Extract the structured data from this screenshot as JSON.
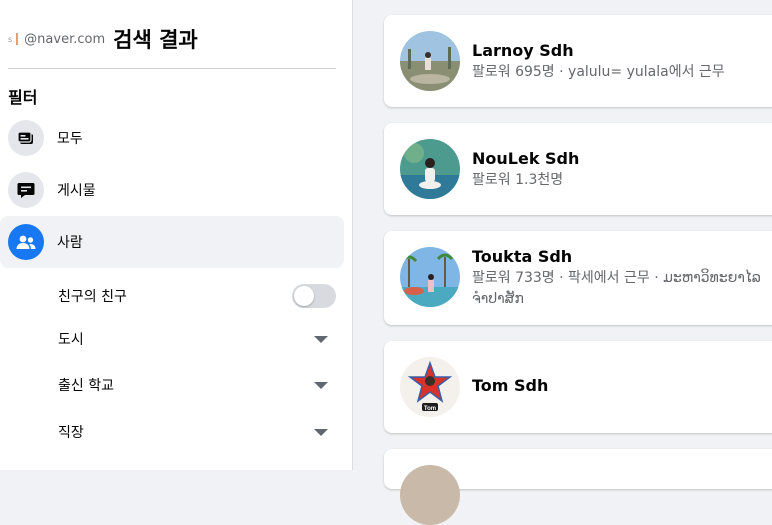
{
  "header": {
    "query_prefix": "s",
    "query_email": "@naver.com",
    "results_title": "검색 결과"
  },
  "filters": {
    "title": "필터",
    "items": [
      {
        "label": "모두",
        "icon": "feed-icon",
        "active": false
      },
      {
        "label": "게시물",
        "icon": "post-icon",
        "active": false
      },
      {
        "label": "사람",
        "icon": "people-icon",
        "active": true
      }
    ],
    "sub_filters": {
      "friends_of_friends": {
        "label": "친구의 친구",
        "enabled": false
      },
      "city": {
        "label": "도시"
      },
      "education": {
        "label": "출신 학교"
      },
      "work": {
        "label": "직장"
      }
    }
  },
  "results": [
    {
      "name": "Larnoy Sdh",
      "info": "팔로워 695명 · yalulu= yulala에서 근무"
    },
    {
      "name": "NouLek Sdh",
      "info": "팔로워 1.3천명"
    },
    {
      "name": "Toukta Sdh",
      "info": "팔로워 733명 · 팍세에서 근무 · ມະຫາວິທະຍາໄລຈຳປາສັກ"
    },
    {
      "name": "Tom Sdh",
      "info": "",
      "avatar_text": "Tom"
    }
  ],
  "colors": {
    "accent": "#1877f2",
    "page_bg": "#f0f2f5",
    "secondary_text": "#65676b"
  }
}
